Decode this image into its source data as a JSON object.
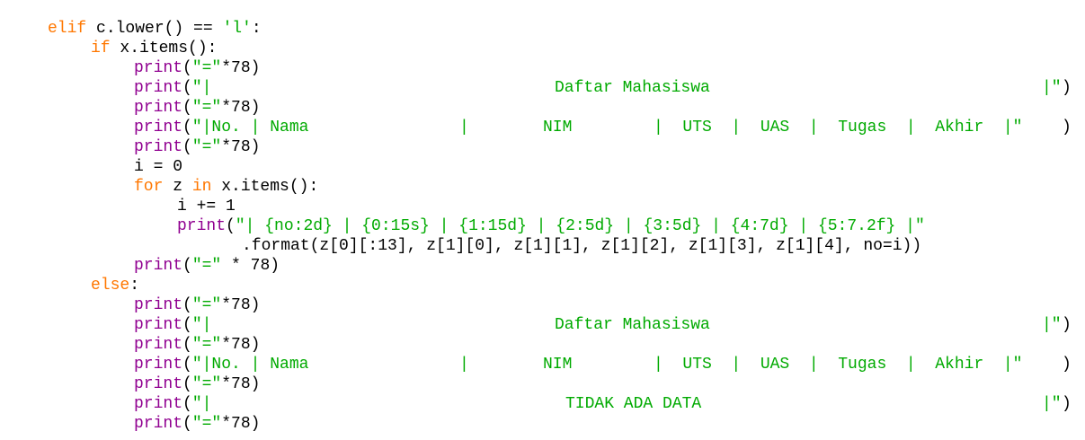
{
  "colors": {
    "background": "#ffffff",
    "keyword": "#ff7700",
    "builtin": "#900090",
    "string": "#00aa00",
    "default": "#000000"
  },
  "lines": [
    {
      "segments": [
        {
          "t": "kw",
          "v": "elif"
        },
        {
          "t": "pl",
          "v": " c.lower() == "
        },
        {
          "t": "str",
          "v": "'l'"
        },
        {
          "t": "pl",
          "v": ":"
        }
      ]
    },
    {
      "segments": [
        {
          "t": "kw",
          "v": "if"
        },
        {
          "t": "pl",
          "v": " x.items():"
        }
      ]
    },
    {
      "segments": [
        {
          "t": "fn",
          "v": "print"
        },
        {
          "t": "pl",
          "v": "("
        },
        {
          "t": "str",
          "v": "\"=\""
        },
        {
          "t": "pl",
          "v": "*78)"
        }
      ]
    },
    {
      "segments": [
        {
          "t": "fn",
          "v": "print"
        },
        {
          "t": "pl",
          "v": "("
        },
        {
          "t": "str",
          "v": "\"|"
        },
        {
          "t": "str",
          "v": "Daftar Mahasiswa",
          "abs": 617
        },
        {
          "t": "str",
          "v": "|\"",
          "abs": 1159
        },
        {
          "t": "pl",
          "v": ")",
          "abs": 1181
        }
      ]
    },
    {
      "segments": [
        {
          "t": "fn",
          "v": "print"
        },
        {
          "t": "pl",
          "v": "("
        },
        {
          "t": "str",
          "v": "\"=\""
        },
        {
          "t": "pl",
          "v": "*78)"
        }
      ]
    },
    {
      "segments": [
        {
          "t": "fn",
          "v": "print"
        },
        {
          "t": "pl",
          "v": "("
        },
        {
          "t": "str",
          "v": "\"|No. | Nama"
        },
        {
          "t": "str",
          "v": "|",
          "abs": 511
        },
        {
          "t": "str",
          "v": "NIM",
          "abs": 604
        },
        {
          "t": "str",
          "v": "|  UTS  |  UAS  |  Tugas  |  Akhir  |\"",
          "abs": 727
        },
        {
          "t": "pl",
          "v": ")",
          "abs": 1181
        }
      ]
    },
    {
      "segments": [
        {
          "t": "fn",
          "v": "print"
        },
        {
          "t": "pl",
          "v": "("
        },
        {
          "t": "str",
          "v": "\"=\""
        },
        {
          "t": "pl",
          "v": "*78)"
        }
      ]
    },
    {
      "segments": [
        {
          "t": "pl",
          "v": "i = 0"
        }
      ]
    },
    {
      "segments": [
        {
          "t": "kw",
          "v": "for"
        },
        {
          "t": "pl",
          "v": " z "
        },
        {
          "t": "kw",
          "v": "in"
        },
        {
          "t": "pl",
          "v": " x.items():"
        }
      ]
    },
    {
      "segments": [
        {
          "t": "pl",
          "v": "i += 1"
        }
      ]
    },
    {
      "segments": [
        {
          "t": "fn",
          "v": "print"
        },
        {
          "t": "pl",
          "v": "("
        },
        {
          "t": "str",
          "v": "\"| {no:2d} | {0:15s} | {1:15d} | {2:5d} | {3:5d} | {4:7d} | {5:7.2f} |\""
        }
      ]
    },
    {
      "segments": [
        {
          "t": "pl",
          "v": ".format(z[0][:13], z[1][0], z[1][1], z[1][2], z[1][3], z[1][4], no=i))"
        }
      ]
    },
    {
      "segments": [
        {
          "t": "fn",
          "v": "print"
        },
        {
          "t": "pl",
          "v": "("
        },
        {
          "t": "str",
          "v": "\"=\""
        },
        {
          "t": "pl",
          "v": " * 78)"
        }
      ]
    },
    {
      "segments": [
        {
          "t": "kw",
          "v": "else"
        },
        {
          "t": "pl",
          "v": ":"
        }
      ]
    },
    {
      "segments": [
        {
          "t": "fn",
          "v": "print"
        },
        {
          "t": "pl",
          "v": "("
        },
        {
          "t": "str",
          "v": "\"=\""
        },
        {
          "t": "pl",
          "v": "*78)"
        }
      ]
    },
    {
      "segments": [
        {
          "t": "fn",
          "v": "print"
        },
        {
          "t": "pl",
          "v": "("
        },
        {
          "t": "str",
          "v": "\"|"
        },
        {
          "t": "str",
          "v": "Daftar Mahasiswa",
          "abs": 617
        },
        {
          "t": "str",
          "v": "|\"",
          "abs": 1159
        },
        {
          "t": "pl",
          "v": ")",
          "abs": 1181
        }
      ]
    },
    {
      "segments": [
        {
          "t": "fn",
          "v": "print"
        },
        {
          "t": "pl",
          "v": "("
        },
        {
          "t": "str",
          "v": "\"=\""
        },
        {
          "t": "pl",
          "v": "*78)"
        }
      ]
    },
    {
      "segments": [
        {
          "t": "fn",
          "v": "print"
        },
        {
          "t": "pl",
          "v": "("
        },
        {
          "t": "str",
          "v": "\"|No. | Nama"
        },
        {
          "t": "str",
          "v": "|",
          "abs": 511
        },
        {
          "t": "str",
          "v": "NIM",
          "abs": 604
        },
        {
          "t": "str",
          "v": "|  UTS  |  UAS  |  Tugas  |  Akhir  |\"",
          "abs": 727
        },
        {
          "t": "pl",
          "v": ")",
          "abs": 1181
        }
      ]
    },
    {
      "segments": [
        {
          "t": "fn",
          "v": "print"
        },
        {
          "t": "pl",
          "v": "("
        },
        {
          "t": "str",
          "v": "\"=\""
        },
        {
          "t": "pl",
          "v": "*78)"
        }
      ]
    },
    {
      "segments": [
        {
          "t": "fn",
          "v": "print"
        },
        {
          "t": "pl",
          "v": "("
        },
        {
          "t": "str",
          "v": "\"|"
        },
        {
          "t": "str",
          "v": "TIDAK ADA DATA",
          "abs": 629
        },
        {
          "t": "str",
          "v": "|\"",
          "abs": 1159
        },
        {
          "t": "pl",
          "v": ")",
          "abs": 1181
        }
      ]
    },
    {
      "segments": [
        {
          "t": "fn",
          "v": "print"
        },
        {
          "t": "pl",
          "v": "("
        },
        {
          "t": "str",
          "v": "\"=\""
        },
        {
          "t": "pl",
          "v": "*78)"
        }
      ]
    }
  ]
}
